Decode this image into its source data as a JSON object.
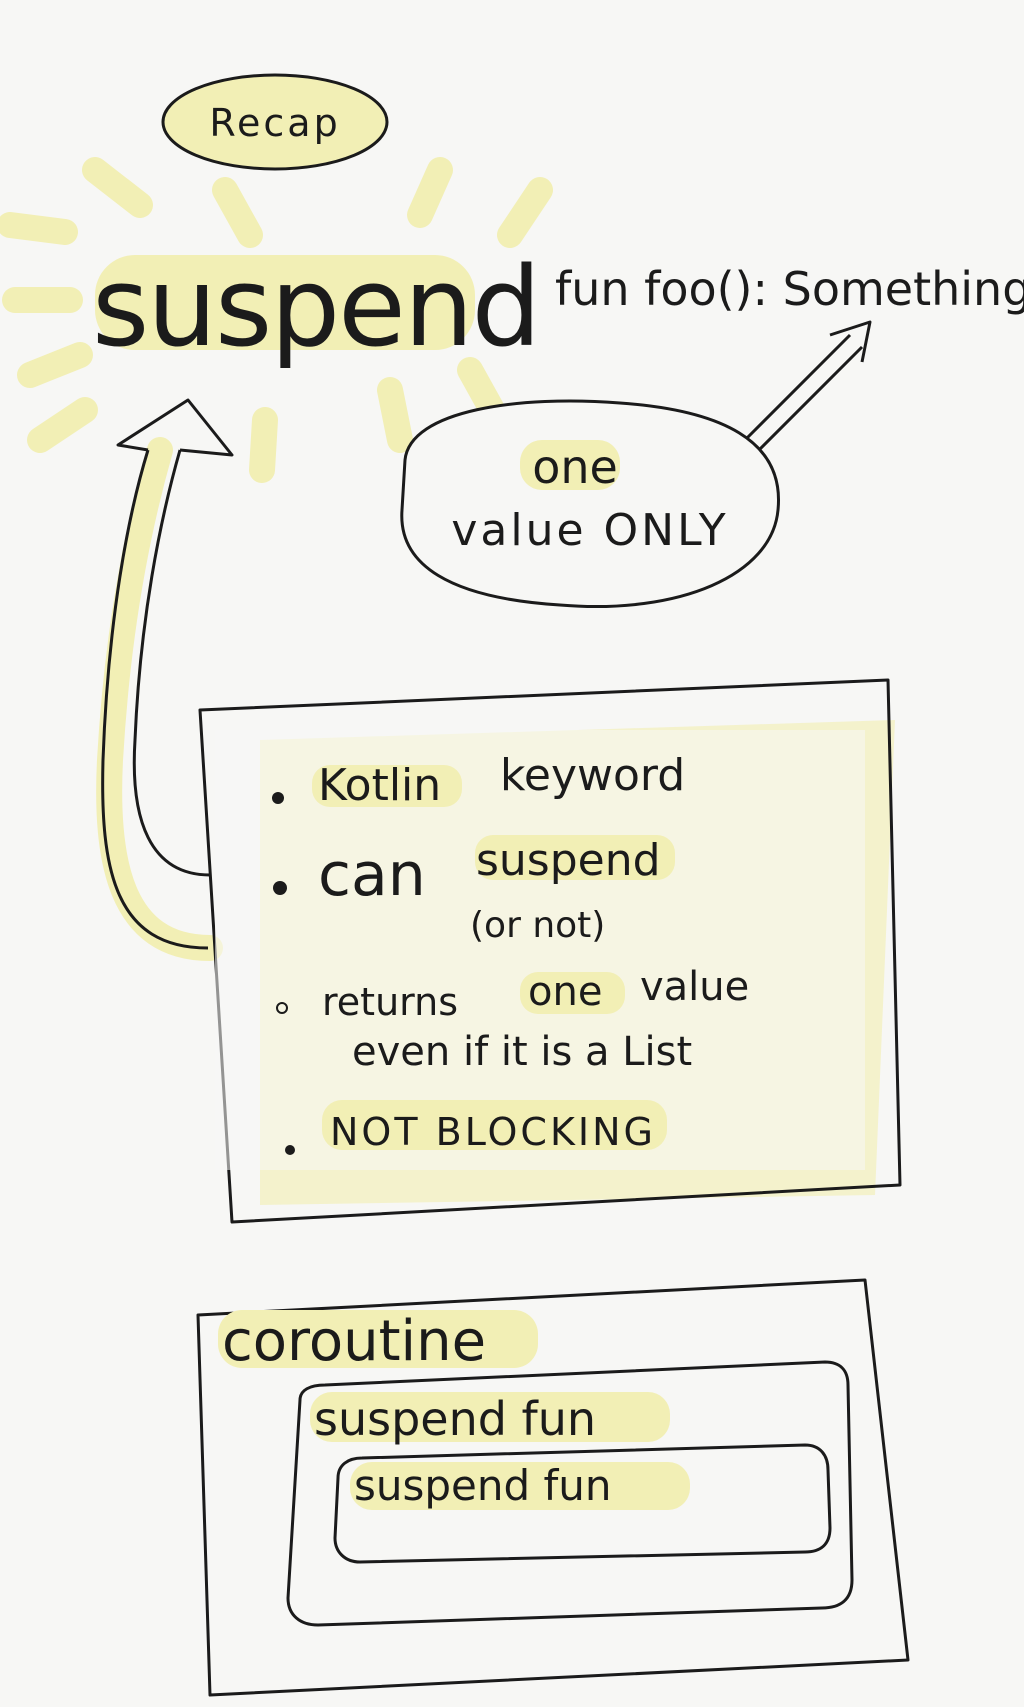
{
  "recap": "Recap",
  "keyword": "suspend",
  "signature": "fun foo(): Something",
  "callout": {
    "line1": "one",
    "line2": "value ONLY"
  },
  "facts": {
    "kotlin_prefix": "Kotlin",
    "kotlin_suffix": "keyword",
    "can": "can",
    "can_suspend": "suspend",
    "or_not": "(or not)",
    "returns_prefix": "returns",
    "returns_one": "one",
    "returns_suffix": "value",
    "returns_line2": "even if it is a List",
    "not_blocking": "NOT BLOCKING"
  },
  "nesting": {
    "outer": "coroutine",
    "middle": "suspend fun",
    "inner": "suspend fun"
  },
  "colors": {
    "highlight": "#f2efb5",
    "ink": "#1b1b1b",
    "paper": "#f7f7f5"
  }
}
